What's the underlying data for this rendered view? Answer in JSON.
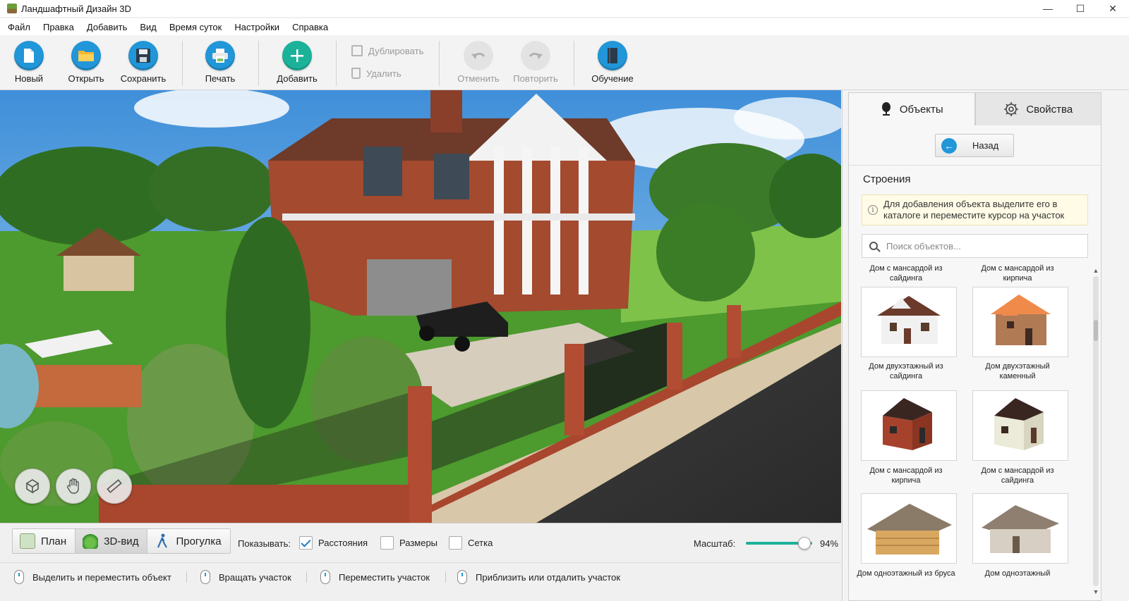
{
  "window": {
    "title": "Ландшафтный Дизайн 3D",
    "minimize_glyph": "—",
    "maximize_glyph": "☐",
    "close_glyph": "✕"
  },
  "menu": [
    "Файл",
    "Правка",
    "Добавить",
    "Вид",
    "Время суток",
    "Настройки",
    "Справка"
  ],
  "toolbar": {
    "new_label": "Новый",
    "open_label": "Открыть",
    "save_label": "Сохранить",
    "print_label": "Печать",
    "add_label": "Добавить",
    "duplicate_label": "Дублировать",
    "delete_label": "Удалить",
    "undo_label": "Отменить",
    "redo_label": "Повторить",
    "tutorial_label": "Обучение"
  },
  "panel": {
    "tab_objects": "Объекты",
    "tab_properties": "Свойства",
    "back_label": "Назад",
    "section_title": "Строения",
    "hint_line1": "Для добавления объекта выделите его в",
    "hint_line2": "каталоге и переместите курсор на участок",
    "search_placeholder": "Поиск объектов...",
    "catalog": {
      "top_captions": [
        {
          "line1": "Дом с мансардой из",
          "line2": "сайдинга"
        },
        {
          "line1": "Дом с мансардой из",
          "line2": "кирпича"
        }
      ],
      "items": [
        {
          "line1": "Дом двухэтажный из",
          "line2": "сайдинга"
        },
        {
          "line1": "Дом двухэтажный",
          "line2": "каменный"
        },
        {
          "line1": "Дом с мансардой из",
          "line2": "кирпича"
        },
        {
          "line1": "Дом с мансардой из",
          "line2": "сайдинга"
        },
        {
          "line1": "Дом одноэтажный из бруса",
          "line2": ""
        },
        {
          "line1": "Дом одноэтажный",
          "line2": ""
        }
      ]
    }
  },
  "bottom": {
    "mode_plan": "План",
    "mode_3d": "3D-вид",
    "mode_walk": "Прогулка",
    "show_label": "Показывать:",
    "chk_distances": "Расстояния",
    "chk_sizes": "Размеры",
    "chk_grid": "Сетка",
    "scale_label": "Масштаб:",
    "scale_value": "94%",
    "scale_fraction": 0.94
  },
  "status": {
    "select_move": "Выделить и переместить объект",
    "rotate": "Вращать участок",
    "move": "Переместить участок",
    "zoom": "Приблизить или отдалить участок"
  },
  "colors": {
    "accent_blue": "#2196d8",
    "accent_teal": "#1bb29a"
  }
}
